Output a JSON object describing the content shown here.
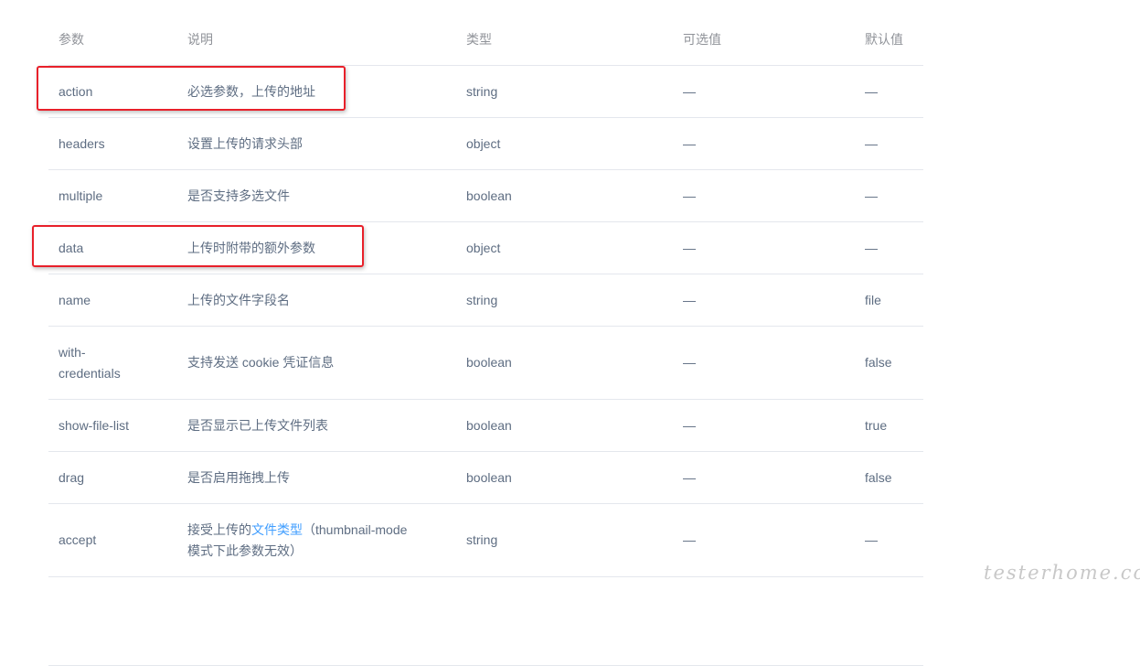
{
  "table": {
    "headers": [
      "参数",
      "说明",
      "类型",
      "可选值",
      "默认值"
    ],
    "rows": [
      {
        "param": "action",
        "desc": "必选参数，上传的地址",
        "type": "string",
        "options": "—",
        "default": "—"
      },
      {
        "param": "headers",
        "desc": "设置上传的请求头部",
        "type": "object",
        "options": "—",
        "default": "—"
      },
      {
        "param": "multiple",
        "desc": "是否支持多选文件",
        "type": "boolean",
        "options": "—",
        "default": "—"
      },
      {
        "param": "data",
        "desc": "上传时附带的额外参数",
        "type": "object",
        "options": "—",
        "default": "—"
      },
      {
        "param": "name",
        "desc": "上传的文件字段名",
        "type": "string",
        "options": "—",
        "default": "file"
      },
      {
        "param_line1": "with-",
        "param_line2": "credentials",
        "desc": "支持发送 cookie 凭证信息",
        "type": "boolean",
        "options": "—",
        "default": "false"
      },
      {
        "param": "show-file-list",
        "desc": "是否显示已上传文件列表",
        "type": "boolean",
        "options": "—",
        "default": "true"
      },
      {
        "param": "drag",
        "desc": "是否启用拖拽上传",
        "type": "boolean",
        "options": "—",
        "default": "false"
      },
      {
        "param": "accept",
        "desc_prefix": "接受上传的",
        "desc_link": "文件类型",
        "desc_suffix": "（thumbnail-mode",
        "desc_line2": "模式下此参数无效）",
        "type": "string",
        "options": "—",
        "default": "—"
      }
    ]
  },
  "watermark": "testerhome.com",
  "colors": {
    "highlight": "#e8202a",
    "link": "#409eff",
    "text": "#5e6d82",
    "header": "#909399",
    "border": "#e4e7ed"
  }
}
